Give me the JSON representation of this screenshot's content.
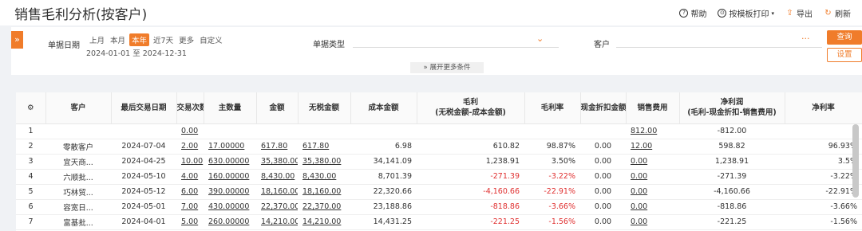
{
  "title": "销售毛利分析(按客户)",
  "top_actions": [
    {
      "label": "帮助",
      "icon": "help-icon"
    },
    {
      "label": "按模板打印",
      "icon": "print-icon"
    },
    {
      "label": "导出",
      "icon": "export-icon"
    },
    {
      "label": "刷新",
      "icon": "refresh-icon"
    }
  ],
  "filter": {
    "date_label": "单据日期",
    "quick": [
      "上月",
      "本月",
      "本年",
      "近7天",
      "更多",
      "自定义"
    ],
    "quick_active": "本年",
    "date_range": "2024-01-01 至 2024-12-31",
    "doctype_label": "单据类型",
    "customer_label": "客户",
    "query_btn": "查询",
    "settings_btn": "设置",
    "more_conditions": "展开更多条件"
  },
  "table": {
    "headers": [
      "客户",
      "最后交易日期",
      "交易次数",
      "主数量",
      "金额",
      "无税金额",
      "成本金额",
      "毛利\n(无税金额-成本金额)",
      "毛利率",
      "现金折扣金额",
      "销售费用",
      "净利润\n(毛利-现金折扣-销售费用)",
      "净利率"
    ],
    "rows": [
      [
        "1",
        "",
        "",
        "0.00",
        "",
        "",
        "",
        "",
        "",
        "",
        "",
        "812.00",
        "-812.00",
        ""
      ],
      [
        "2",
        "零散客户",
        "2024-07-04",
        "2.00",
        "17.00000",
        "617.80",
        "617.80",
        "6.98",
        "610.82",
        "98.87%",
        "0.00",
        "12.00",
        "598.82",
        "96.93%"
      ],
      [
        "3",
        "宜天商...",
        "2024-04-25",
        "10.00",
        "630.00000",
        "35,380.00",
        "35,380.00",
        "34,141.09",
        "1,238.91",
        "3.50%",
        "0.00",
        "0.00",
        "1,238.91",
        "3.5%"
      ],
      [
        "4",
        "六顺批...",
        "2024-05-10",
        "4.00",
        "160.00000",
        "8,430.00",
        "8,430.00",
        "8,701.39",
        "-271.39",
        "-3.22%",
        "0.00",
        "0.00",
        "-271.39",
        "-3.22%"
      ],
      [
        "5",
        "巧林贸...",
        "2024-05-12",
        "6.00",
        "390.00000",
        "18,160.00",
        "18,160.00",
        "22,320.66",
        "-4,160.66",
        "-22.91%",
        "0.00",
        "0.00",
        "-4,160.66",
        "-22.91%"
      ],
      [
        "6",
        "容宽日...",
        "2024-05-01",
        "7.00",
        "430.00000",
        "22,370.00",
        "22,370.00",
        "23,188.86",
        "-818.86",
        "-3.66%",
        "0.00",
        "0.00",
        "-818.86",
        "-3.66%"
      ],
      [
        "7",
        "富基批...",
        "2024-04-01",
        "5.00",
        "260.00000",
        "14,210.00",
        "14,210.00",
        "14,431.25",
        "-221.25",
        "-1.56%",
        "0.00",
        "0.00",
        "-221.25",
        "-1.56%"
      ]
    ]
  },
  "colors": {
    "accent": "#f07c2a",
    "negative": "#e03030"
  }
}
